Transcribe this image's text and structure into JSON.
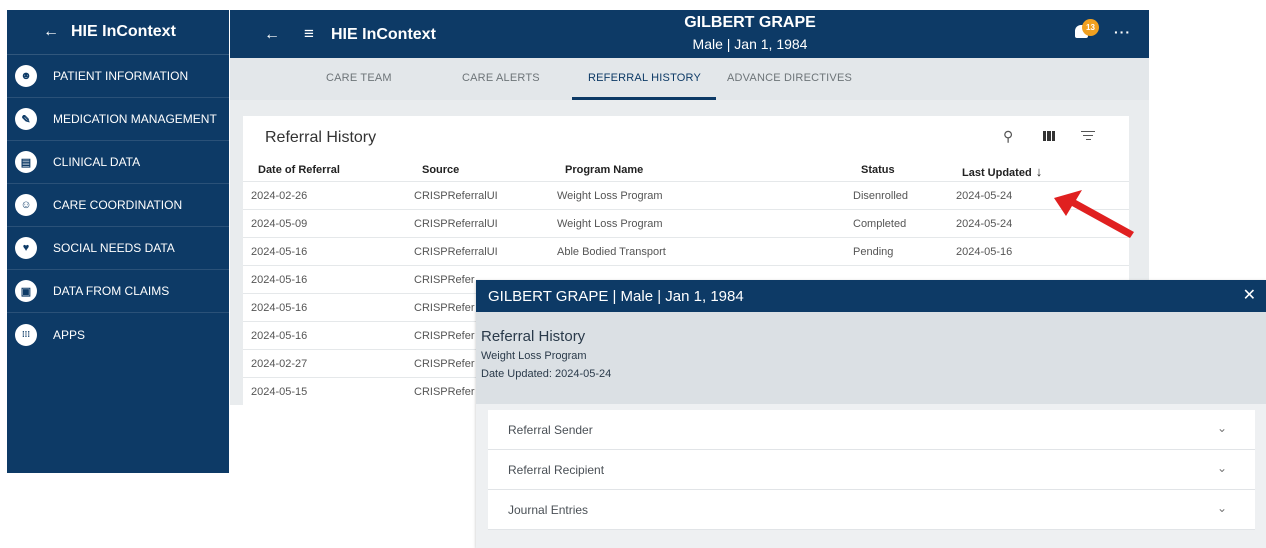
{
  "sidebar": {
    "back_icon": "arrow-left",
    "title": "HIE InContext",
    "items": [
      {
        "label": "PATIENT INFORMATION",
        "icon": "person-icon",
        "glyph": "☻"
      },
      {
        "label": "MEDICATION MANAGEMENT",
        "icon": "pill-icon",
        "glyph": "✎"
      },
      {
        "label": "CLINICAL DATA",
        "icon": "folder-icon",
        "glyph": "▤"
      },
      {
        "label": "CARE COORDINATION",
        "icon": "coordination-icon",
        "glyph": "☺"
      },
      {
        "label": "SOCIAL NEEDS DATA",
        "icon": "heart-hand-icon",
        "glyph": "♥"
      },
      {
        "label": "DATA FROM CLAIMS",
        "icon": "document-icon",
        "glyph": "▣"
      },
      {
        "label": "APPS",
        "icon": "apps-grid-icon",
        "glyph": "⁞⁞⁞"
      }
    ]
  },
  "topbar": {
    "back_glyph": "←",
    "menu_glyph": "≡",
    "title": "HIE InContext",
    "patient_name": "GILBERT GRAPE",
    "patient_demo": "Male | Jan 1, 1984",
    "notification_count": "13",
    "more_glyph": "···"
  },
  "tabs": [
    "CARE TEAM",
    "CARE ALERTS",
    "REFERRAL HISTORY",
    "ADVANCE DIRECTIVES"
  ],
  "active_tab": "REFERRAL HISTORY",
  "referral_history": {
    "title": "Referral History",
    "columns": [
      "Date of Referral",
      "Source",
      "Program Name",
      "Status",
      "Last Updated"
    ],
    "sort_glyph": "↓",
    "rows": [
      {
        "date": "2024-02-26",
        "source": "CRISPReferralUI",
        "program": "Weight Loss Program",
        "status": "Disenrolled",
        "updated": "2024-05-24"
      },
      {
        "date": "2024-05-09",
        "source": "CRISPReferralUI",
        "program": "Weight Loss Program",
        "status": "Completed",
        "updated": "2024-05-24"
      },
      {
        "date": "2024-05-16",
        "source": "CRISPReferralUI",
        "program": "Able Bodied Transport",
        "status": "Pending",
        "updated": "2024-05-16"
      },
      {
        "date": "2024-05-16",
        "source": "CRISPRefer"
      },
      {
        "date": "2024-05-16",
        "source": "CRISPRefer"
      },
      {
        "date": "2024-05-16",
        "source": "CRISPRefer"
      },
      {
        "date": "2024-02-27",
        "source": "CRISPRefer"
      },
      {
        "date": "2024-05-15",
        "source": "CRISPRefer"
      }
    ]
  },
  "modal": {
    "title": "GILBERT GRAPE | Male | Jan 1, 1984",
    "close_glyph": "✕",
    "heading": "Referral History",
    "program": "Weight Loss Program",
    "date_updated": "Date Updated: 2024-05-24",
    "sections": [
      "Referral Sender",
      "Referral Recipient",
      "Journal Entries"
    ],
    "chevron_glyph": "⌄"
  },
  "colors": {
    "navy": "#0d3a66",
    "badge": "#f0a020",
    "arrow": "#e02020"
  }
}
